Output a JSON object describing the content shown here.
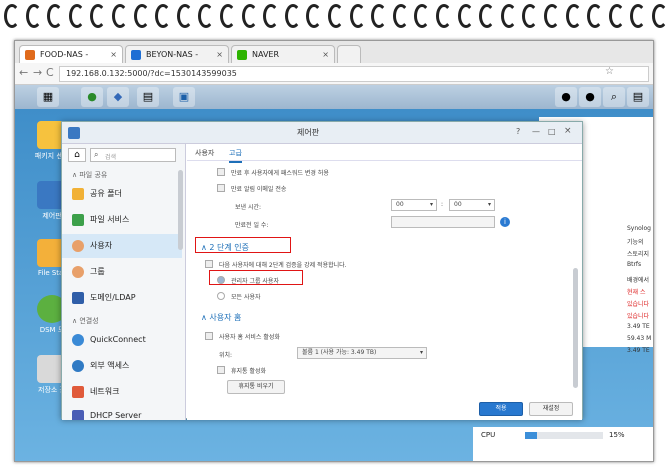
{
  "browser": {
    "tabs": [
      {
        "label": "FOOD-NAS - Synology",
        "close": "×",
        "color": "#e06a1b"
      },
      {
        "label": "BEYON-NAS - Synolog",
        "close": "×",
        "color": "#1e6ed4"
      },
      {
        "label": "NAVER",
        "close": "×",
        "color": "#2db400"
      }
    ],
    "url": "192.168.0.132:5000/?dc=1530143599035",
    "back": "←",
    "forward": "→",
    "reload": "C",
    "star": "☆"
  },
  "dsm": {
    "taskbar_icons": [
      "apps-grid-icon",
      "package-center-icon",
      "control-panel-icon",
      "file-icon",
      "window-icon"
    ],
    "right_icons": [
      "chat-icon",
      "user-icon",
      "search-icon",
      "layout-icon"
    ],
    "desktop_icons": [
      {
        "label": "패키지 센터",
        "icon": "package-icon"
      },
      {
        "label": "제어판",
        "icon": "control-panel-icon"
      },
      {
        "label": "File Stat",
        "icon": "folder-icon"
      },
      {
        "label": "DSM 도",
        "icon": "help-icon"
      },
      {
        "label": "저장소 관",
        "icon": "storage-icon"
      }
    ],
    "right_panel": [
      "Synolog",
      "기능의",
      "스토리지",
      "Btrfs",
      "배경에서",
      "현재 스",
      "있습니다",
      "있습니다",
      "3.49 TE",
      "59.43 M",
      "3.49 TE"
    ],
    "resource": {
      "cpu_label": "CPU",
      "cpu_value": "15%",
      "cpu_fraction": 0.15
    }
  },
  "window": {
    "title": "제어판",
    "controls": [
      "?",
      "—",
      "□",
      "×"
    ],
    "search_placeholder": "검색",
    "sidebar": {
      "group1": "파일 공유",
      "items": [
        {
          "label": "공유 폴더",
          "icon": "shared-folder-icon"
        },
        {
          "label": "파일 서비스",
          "icon": "file-service-icon"
        },
        {
          "label": "사용자",
          "icon": "user-icon"
        },
        {
          "label": "그룹",
          "icon": "group-icon"
        },
        {
          "label": "도메인/LDAP",
          "icon": "domain-icon"
        }
      ],
      "group2": "연결성",
      "items2": [
        {
          "label": "QuickConnect",
          "icon": "quickconnect-icon"
        },
        {
          "label": "외부 액세스",
          "icon": "external-access-icon"
        },
        {
          "label": "네트워크",
          "icon": "network-icon"
        },
        {
          "label": "DHCP Server",
          "icon": "dhcp-icon"
        }
      ]
    },
    "tabs": [
      "사용자",
      "고급"
    ],
    "settings": {
      "opt1": "만료 후 사용자에게 패스워드 변경 허용",
      "opt2": "만료 알림 이메일 전송",
      "send_time_label": "보낸 시간:",
      "time_hour": "00",
      "time_min": "00",
      "days_label": "만료전 일 수:",
      "twofa_title": "2 단계 인증",
      "twofa_enforce": "다음 사용자에 대해 2단계 검증을 강제 적용합니다.",
      "twofa_admin": "관리자 그룹 사용자",
      "twofa_all": "모든 사용자",
      "home_title": "사용자 홈",
      "home_enable": "사용자 홈 서비스 활성화",
      "location_label": "위치:",
      "location_value": "볼륨 1 (사용 가능: 3.49 TB)",
      "recycle": "휴지통 활성화",
      "empty_recycle": "휴지통 비우기"
    },
    "apply": "적용",
    "reset": "재설정"
  }
}
